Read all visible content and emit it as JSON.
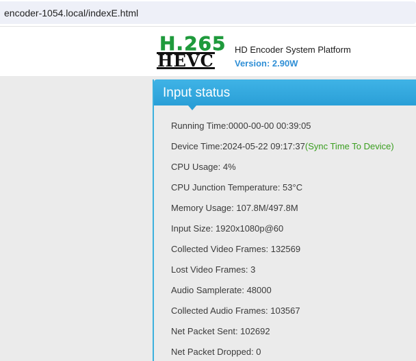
{
  "browser": {
    "url": "encoder-1054.local/indexE.html"
  },
  "header": {
    "logo_top": "H.265",
    "logo_bottom": "HEVC",
    "title": "HD Encoder System Platform",
    "version": "Version: 2.90W"
  },
  "panel": {
    "title": "Input status",
    "running_time": "Running Time:0000-00-00 00:39:05",
    "device_time": "Device Time:2024-05-22 09:17:37",
    "sync_link": "(Sync Time To Device)",
    "cpu_usage": "CPU Usage: 4%",
    "cpu_temp": "CPU Junction Temperature: 53°C",
    "memory_usage": "Memory Usage: 107.8M/497.8M",
    "input_size": "Input Size: 1920x1080p@60",
    "collected_video": "Collected Video Frames: 132569",
    "lost_video": "Lost Video Frames: 3",
    "audio_samplerate": "Audio Samplerate: 48000",
    "collected_audio": "Collected Audio Frames: 103567",
    "net_sent": "Net Packet Sent: 102692",
    "net_dropped": "Net Packet Dropped: 0"
  },
  "colors": {
    "panel_header": "#2a9fd7",
    "version_blue": "#2f8fd6",
    "logo_green": "#1f9a3c",
    "sync_green": "#3a9e1f"
  }
}
